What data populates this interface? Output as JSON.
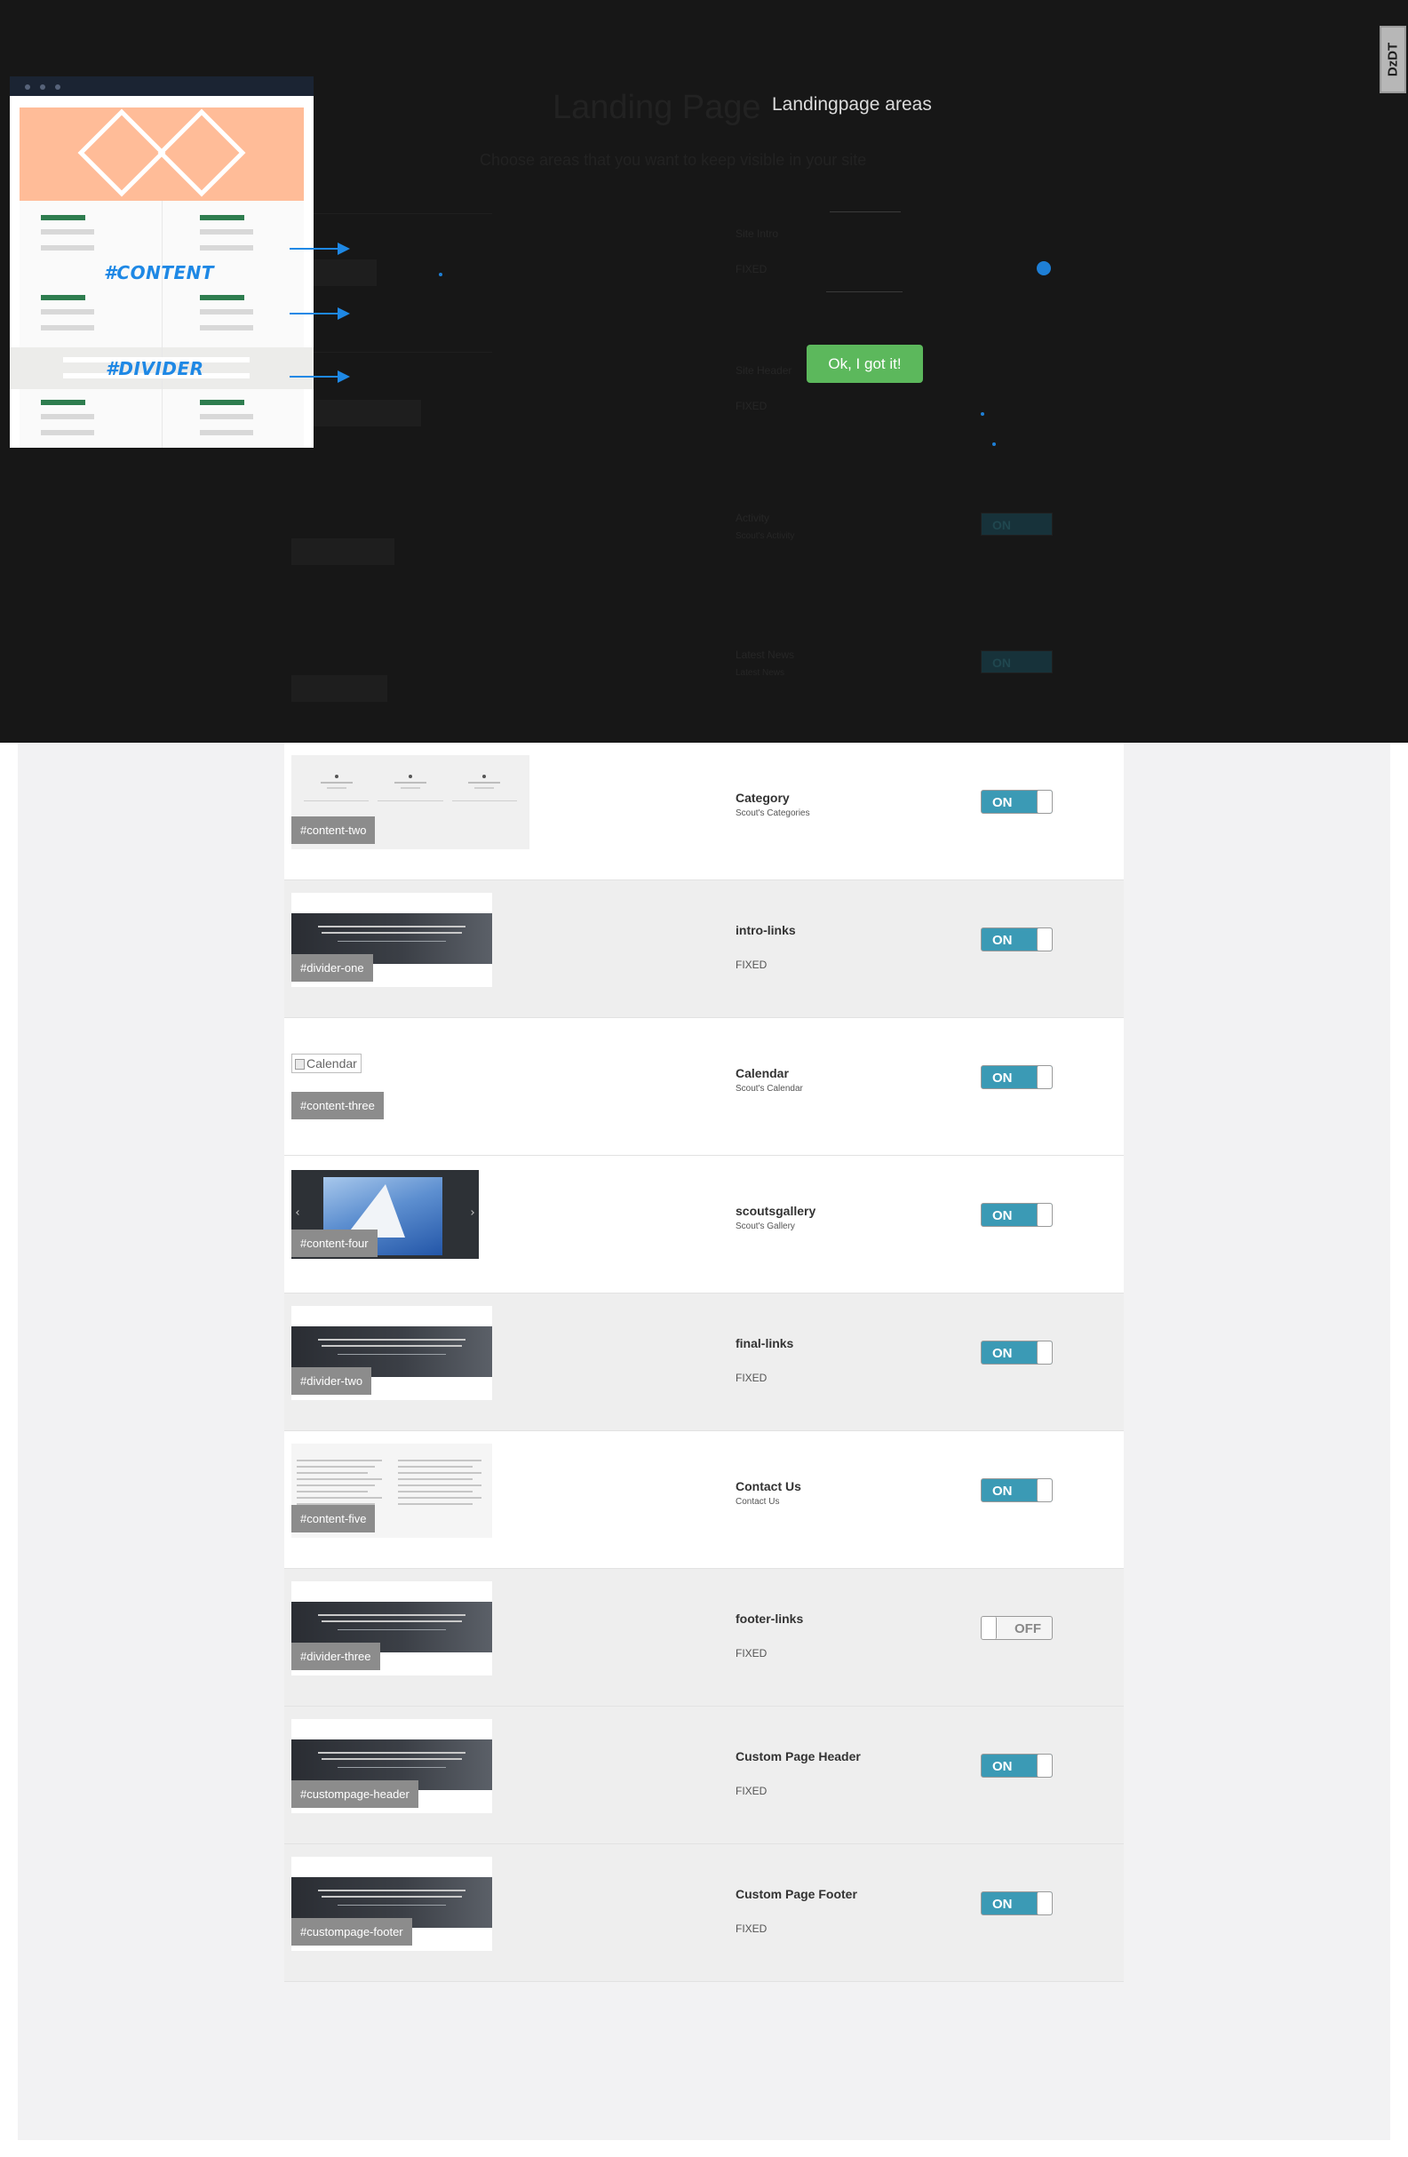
{
  "tour": {
    "popover_title": "Landingpage areas",
    "ok_button": "Ok, I got it!",
    "background_title": "Landing Page",
    "background_subtitle": "Choose areas that you want to keep visible in your site",
    "illustration_labels": [
      "#CONTENT",
      "#DIVIDER"
    ],
    "logo": "DzDT"
  },
  "hidden_rows": [
    {
      "title": "Site Intro",
      "subtitle": "FIXED"
    },
    {
      "title": "Site Header",
      "subtitle": "FIXED"
    },
    {
      "title": "Activity",
      "subtitle": "Scout's Activity",
      "toggle": "ON"
    },
    {
      "title": "Latest News",
      "subtitle": "Latest News",
      "toggle": "ON"
    }
  ],
  "areas": [
    {
      "tag": "#content-two",
      "title": "Category",
      "subtitle": "Scout's Categories",
      "fixed": "",
      "toggle": "ON",
      "thumb_type": "categories",
      "shade": false
    },
    {
      "tag": "#divider-one",
      "title": "intro-links",
      "subtitle": "",
      "fixed": "FIXED",
      "toggle": "ON",
      "thumb_type": "banner",
      "shade": true
    },
    {
      "tag": "#content-three",
      "title": "Calendar",
      "subtitle": "Scout's Calendar",
      "fixed": "",
      "toggle": "ON",
      "thumb_type": "broken",
      "thumb_alt": "Calendar",
      "shade": false
    },
    {
      "tag": "#content-four",
      "title": "scoutsgallery",
      "subtitle": "Scout's Gallery",
      "fixed": "",
      "toggle": "ON",
      "thumb_type": "gallery",
      "shade": false
    },
    {
      "tag": "#divider-two",
      "title": "final-links",
      "subtitle": "",
      "fixed": "FIXED",
      "toggle": "ON",
      "thumb_type": "banner",
      "shade": true
    },
    {
      "tag": "#content-five",
      "title": "Contact Us",
      "subtitle": "Contact Us",
      "fixed": "",
      "toggle": "ON",
      "thumb_type": "contact",
      "shade": false
    },
    {
      "tag": "#divider-three",
      "title": "footer-links",
      "subtitle": "",
      "fixed": "FIXED",
      "toggle": "OFF",
      "thumb_type": "banner",
      "shade": true
    },
    {
      "tag": "#custompage-header",
      "title": "Custom Page Header",
      "subtitle": "",
      "fixed": "FIXED",
      "toggle": "ON",
      "thumb_type": "banner",
      "shade": true
    },
    {
      "tag": "#custompage-footer",
      "title": "Custom Page Footer",
      "subtitle": "",
      "fixed": "FIXED",
      "toggle": "ON",
      "thumb_type": "banner",
      "shade": true
    }
  ],
  "colors": {
    "toggle_on": "#3b9ab5",
    "ok_button": "#5cb85c",
    "accent_blue": "#1e88e5",
    "hero_peach": "#ffbc98",
    "overlay": "#171717"
  }
}
